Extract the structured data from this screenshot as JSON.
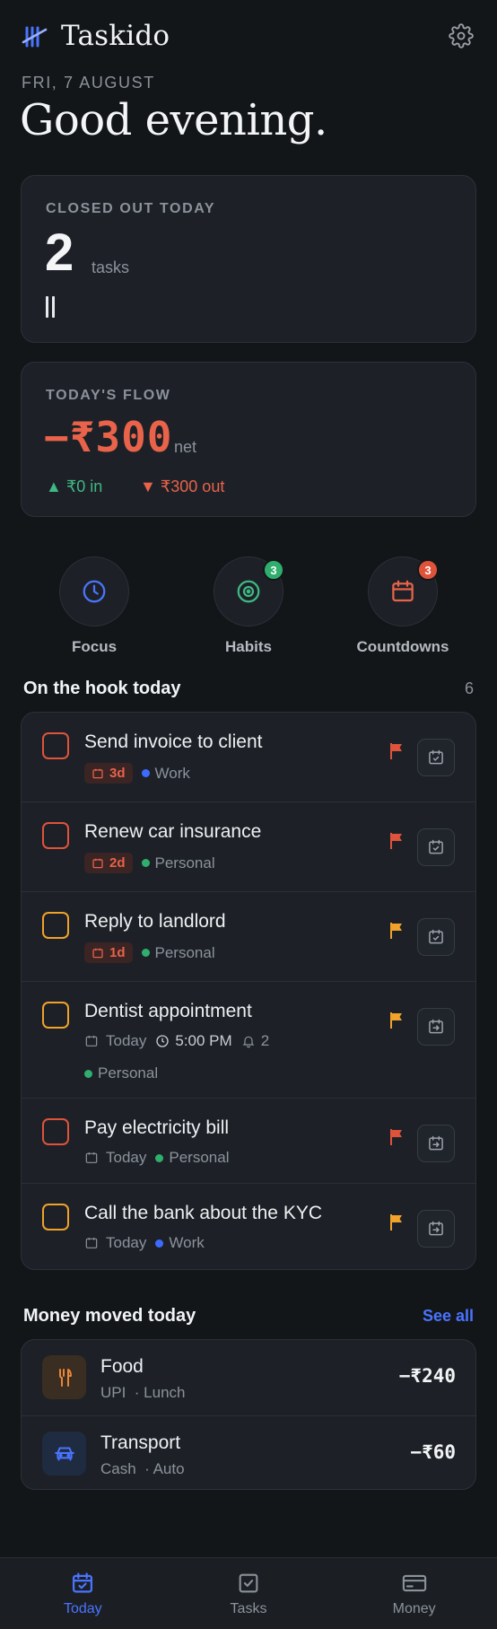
{
  "app": {
    "name": "Taskido"
  },
  "header": {
    "date": "FRI, 7 AUGUST",
    "greeting": "Good evening."
  },
  "closed_out": {
    "label": "CLOSED OUT TODAY",
    "count": "2",
    "unit": "tasks",
    "tally_marks": 2
  },
  "flow": {
    "label": "TODAY'S FLOW",
    "net": "−₹300",
    "net_unit": "net",
    "in": "▲ ₹0 in",
    "out": "▼ ₹300 out"
  },
  "shortcuts": [
    {
      "label": "Focus",
      "icon": "clock-icon",
      "badge": ""
    },
    {
      "label": "Habits",
      "icon": "target-icon",
      "badge": "3"
    },
    {
      "label": "Countdowns",
      "icon": "calendar-icon",
      "badge": "3"
    }
  ],
  "tasks_section": {
    "title": "On the hook today",
    "count": "6"
  },
  "tasks": [
    {
      "title": "Send invoice to client",
      "priority": "high",
      "due_chip": "3d",
      "tag": "Work",
      "tag_color": "#3d6bff",
      "schedule_icon": "calendar-check-icon"
    },
    {
      "title": "Renew car insurance",
      "priority": "high",
      "due_chip": "2d",
      "tag": "Personal",
      "tag_color": "#2fae6e",
      "schedule_icon": "calendar-check-icon"
    },
    {
      "title": "Reply to landlord",
      "priority": "medium",
      "due_chip": "1d",
      "tag": "Personal",
      "tag_color": "#2fae6e",
      "schedule_icon": "calendar-check-icon"
    },
    {
      "title": "Dentist appointment",
      "priority": "medium",
      "when": "Today",
      "time": "5:00 PM",
      "reminders": "2",
      "tag": "Personal",
      "tag_color": "#2fae6e",
      "schedule_icon": "calendar-arrow-icon"
    },
    {
      "title": "Pay electricity bill",
      "priority": "high",
      "when": "Today",
      "tag": "Personal",
      "tag_color": "#2fae6e",
      "schedule_icon": "calendar-arrow-icon"
    },
    {
      "title": "Call the bank about the KYC",
      "priority": "medium",
      "when": "Today",
      "tag": "Work",
      "tag_color": "#3d6bff",
      "schedule_icon": "calendar-arrow-icon"
    }
  ],
  "money_section": {
    "title": "Money moved today",
    "see_all": "See all"
  },
  "transactions": [
    {
      "name": "Food",
      "method": "UPI",
      "note": "· Lunch",
      "amount": "−₹240",
      "icon": "utensils-icon"
    },
    {
      "name": "Transport",
      "method": "Cash",
      "note": "· Auto",
      "amount": "−₹60",
      "icon": "car-icon"
    }
  ],
  "nav": [
    {
      "label": "Today",
      "icon": "calendar-check-icon",
      "active": true
    },
    {
      "label": "Tasks",
      "icon": "checkbox-icon",
      "active": false
    },
    {
      "label": "Money",
      "icon": "wallet-card-icon",
      "active": false
    }
  ],
  "colors": {
    "background": "#131619",
    "card": "#1d2127",
    "accent": "#4a74ff",
    "danger": "#e8634a",
    "warning": "#f0a22a",
    "success": "#3fb883"
  }
}
